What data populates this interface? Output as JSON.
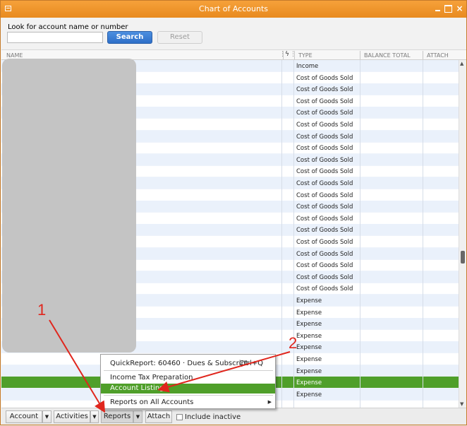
{
  "window": {
    "title": "Chart of Accounts",
    "close_glyph": "×"
  },
  "search": {
    "label": "Look for account name or number",
    "value": "",
    "placeholder": "",
    "search_label": "Search",
    "reset_label": "Reset"
  },
  "columns": {
    "name": "NAME",
    "online_icon": "lightning-icon",
    "type": "TYPE",
    "balance": "BALANCE TOTAL",
    "attach": "ATTACH"
  },
  "rows": [
    "Income",
    "Cost of Goods Sold",
    "Cost of Goods Sold",
    "Cost of Goods Sold",
    "Cost of Goods Sold",
    "Cost of Goods Sold",
    "Cost of Goods Sold",
    "Cost of Goods Sold",
    "Cost of Goods Sold",
    "Cost of Goods Sold",
    "Cost of Goods Sold",
    "Cost of Goods Sold",
    "Cost of Goods Sold",
    "Cost of Goods Sold",
    "Cost of Goods Sold",
    "Cost of Goods Sold",
    "Cost of Goods Sold",
    "Cost of Goods Sold",
    "Cost of Goods Sold",
    "Cost of Goods Sold",
    "Expense",
    "Expense",
    "Expense",
    "Expense",
    "Expense",
    "Expense",
    "Expense",
    "Expense",
    "Expense"
  ],
  "selected_row_index": 27,
  "context_menu": {
    "items": [
      {
        "label": "QuickReport: 60460 · Dues & Subscript",
        "shortcut": "Ctrl+Q"
      },
      {
        "label": "Income Tax Preparation"
      },
      {
        "label": "Account Listing",
        "highlighted": true
      },
      {
        "label": "Reports on All Accounts",
        "submenu": true
      }
    ]
  },
  "bottom": {
    "account_label": "Account",
    "activities_label": "Activities",
    "reports_label": "Reports",
    "attach_label": "Attach",
    "include_inactive_label": "Include inactive",
    "dropdown_glyph": "▼"
  },
  "annotations": {
    "step1": "1",
    "step2": "2"
  },
  "colors": {
    "titlebar": "#f0952b",
    "selection": "#4f9f2a",
    "search_button": "#3a7ad4",
    "annotation": "#e0261d"
  }
}
